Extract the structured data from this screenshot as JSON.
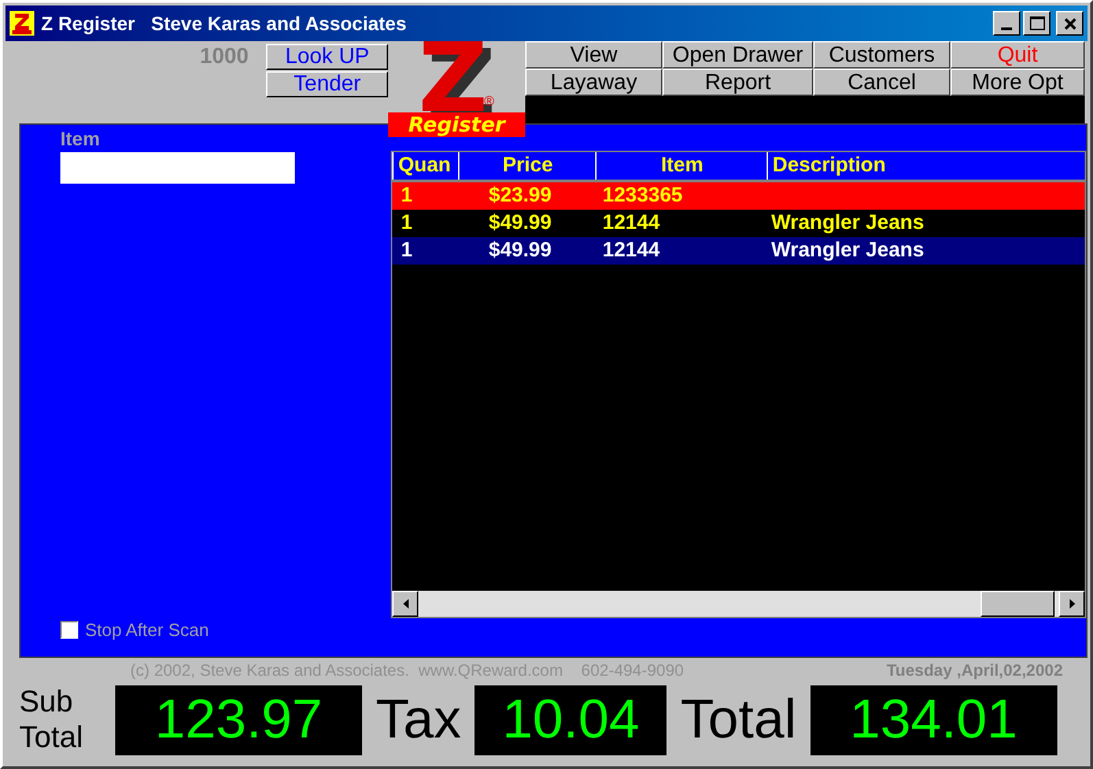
{
  "window": {
    "title": "Z Register   Steve Karas and Associates"
  },
  "counter": "1000",
  "side_buttons": [
    "Look UP",
    "Tender"
  ],
  "logo": {
    "letter": "Z",
    "mark": "®",
    "caption": "Register"
  },
  "menu_buttons": [
    {
      "label": "View",
      "kind": "normal"
    },
    {
      "label": "Open Drawer",
      "kind": "normal"
    },
    {
      "label": "Customers",
      "kind": "normal"
    },
    {
      "label": "Quit",
      "kind": "danger"
    },
    {
      "label": "Layaway",
      "kind": "normal"
    },
    {
      "label": "Report",
      "kind": "normal"
    },
    {
      "label": "Cancel",
      "kind": "normal"
    },
    {
      "label": "More Opt",
      "kind": "normal"
    }
  ],
  "item_field": {
    "label": "Item"
  },
  "table": {
    "columns": [
      "Quan",
      "Price",
      "Item",
      "Description"
    ],
    "rows": [
      {
        "cells": [
          "1",
          "$23.99",
          "1233365",
          ""
        ],
        "flagged": true,
        "selected": false
      },
      {
        "cells": [
          "1",
          "$49.99",
          "12144",
          "Wrangler Jeans"
        ],
        "flagged": false,
        "selected": false
      },
      {
        "cells": [
          "1",
          "$49.99",
          "12144",
          "Wrangler Jeans"
        ],
        "flagged": false,
        "selected": true
      }
    ]
  },
  "stop_after_scan": {
    "label": "Stop After Scan",
    "checked": false
  },
  "footer": {
    "copyright": "(c) 2002, Steve Karas and Associates.  www.QReward.com    602-494-9090",
    "date": "Tuesday ,April,02,2002"
  },
  "totals": [
    {
      "label": "Sub Total",
      "value": "123.97"
    },
    {
      "label": "Tax",
      "value": "10.04"
    },
    {
      "label": "Total",
      "value": "134.01"
    }
  ]
}
